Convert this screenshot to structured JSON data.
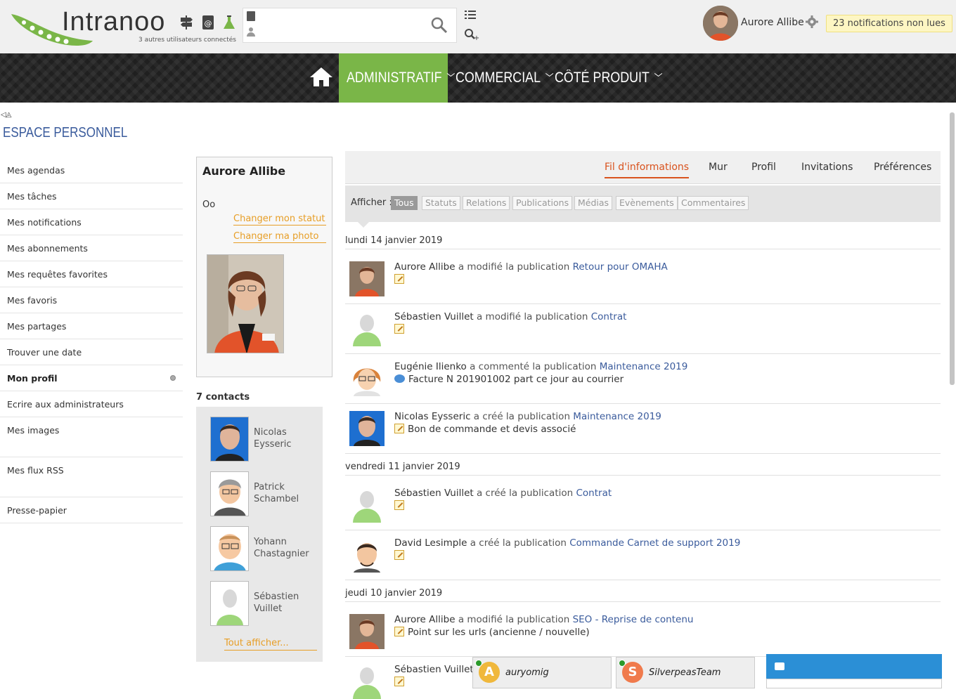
{
  "header": {
    "logo_text": "Intranoo",
    "connected_text": "3 autres utilisateurs connectés",
    "search_placeholder": "",
    "user_name": "Aurore Allibe",
    "notifications": "23 notifications non lues"
  },
  "nav": {
    "items": [
      "ADMINISTRATIF",
      "COMMERCIAL",
      "CÔTÉ PRODUIT"
    ],
    "active_color": "#7ab648"
  },
  "page": {
    "collapse_glyphs": "◁◬",
    "title": "ESPACE PERSONNEL"
  },
  "leftmenu": {
    "items": [
      "Mes agendas",
      "Mes tâches",
      "Mes notifications",
      "Mes abonnements",
      "Mes requêtes favorites",
      "Mes favoris",
      "Mes partages",
      "Trouver une date",
      "Mon profil",
      "Ecrire aux administrateurs",
      "Mes images",
      "Mes flux RSS",
      "Presse-papier"
    ]
  },
  "profile": {
    "name": "Aurore Allibe",
    "status": "Oo",
    "change_status": "Changer mon statut",
    "change_photo": "Changer ma photo"
  },
  "contacts": {
    "title": "7 contacts",
    "items": [
      "Nicolas Eysseric",
      "Patrick Schambel",
      "Yohann Chastagnier",
      "Sébastien Vuillet"
    ],
    "show_all": "Tout afficher..."
  },
  "feed": {
    "tabs": [
      "Fil d'informations",
      "Mur",
      "Profil",
      "Invitations",
      "Préférences"
    ],
    "filter_label": "Afficher :",
    "filters": [
      "Tous",
      "Statuts",
      "Relations",
      "Publications",
      "Médias",
      "Evènements",
      "Commentaires"
    ],
    "dates": [
      "lundi 14 janvier 2019",
      "vendredi 11 janvier 2019",
      "jeudi 10 janvier 2019"
    ],
    "entries": [
      {
        "author": "Aurore Allibe",
        "action": " a modifié la publication ",
        "target": "Retour pour OMAHA",
        "sub": ""
      },
      {
        "author": "Sébastien Vuillet",
        "action": " a modifié la publication ",
        "target": "Contrat",
        "sub": ""
      },
      {
        "author": "Eugénie Ilienko",
        "action": " a commenté la publication ",
        "target": "Maintenance 2019",
        "sub": "Facture N 201901002 part ce jour au courrier"
      },
      {
        "author": "Nicolas Eysseric",
        "action": " a créé la publication ",
        "target": "Maintenance 2019",
        "sub": "Bon de commande et devis associé"
      },
      {
        "author": "Sébastien Vuillet",
        "action": " a créé la publication ",
        "target": "Contrat",
        "sub": ""
      },
      {
        "author": "David Lesimple",
        "action": " a créé la publication ",
        "target": "Commande Carnet de support 2019",
        "sub": ""
      },
      {
        "author": "Aurore Allibe",
        "action": " a modifié la publication ",
        "target": "SEO - Reprise de contenu",
        "sub": "Point sur les urls (ancienne / nouvelle)"
      },
      {
        "author": "Sébastien Vuillet",
        "action": "",
        "target": "",
        "sub": ""
      }
    ]
  },
  "chat": {
    "windows": [
      {
        "initial": "A",
        "name": "auryomig",
        "color": "#f0b83c"
      },
      {
        "initial": "S",
        "name": "SilverpeasTeam",
        "color": "#f07a4c"
      }
    ]
  }
}
